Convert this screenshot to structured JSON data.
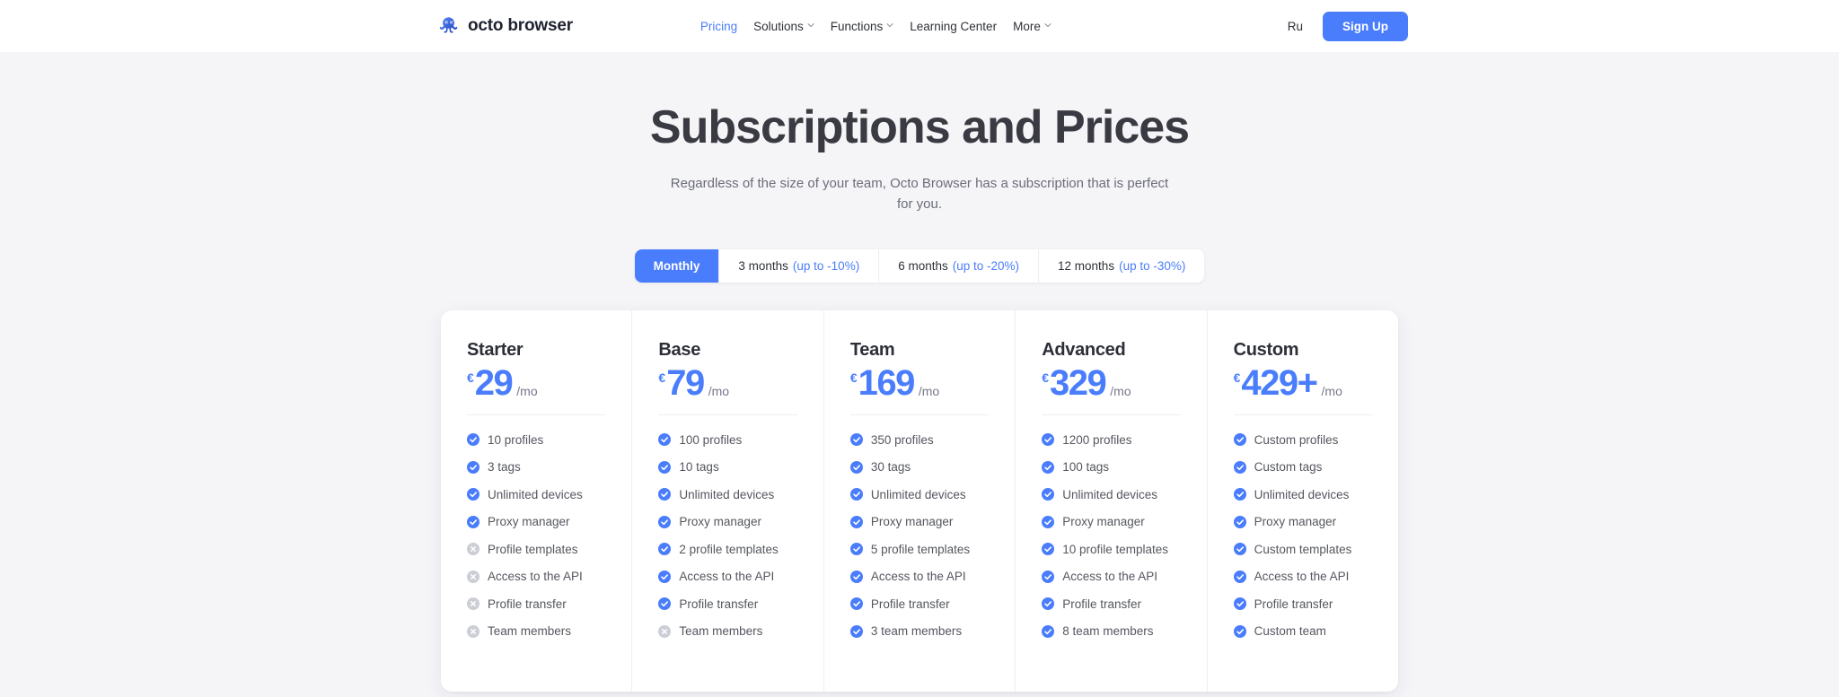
{
  "header": {
    "brand": {
      "name": "octo browser",
      "logo_icon": "octopus-logo-icon"
    },
    "nav": [
      {
        "label": "Pricing",
        "active": true,
        "has_caret": false
      },
      {
        "label": "Solutions",
        "active": false,
        "has_caret": true
      },
      {
        "label": "Functions",
        "active": false,
        "has_caret": true
      },
      {
        "label": "Learning Center",
        "active": false,
        "has_caret": false
      },
      {
        "label": "More",
        "active": false,
        "has_caret": true
      }
    ],
    "language": "Ru",
    "signup_label": "Sign Up"
  },
  "hero": {
    "title": "Subscriptions and Prices",
    "subtitle": "Regardless of the size of your team, Octo Browser has a subscription that is perfect for you."
  },
  "billing": {
    "tabs": [
      {
        "label": "Monthly",
        "discount": "",
        "active": true
      },
      {
        "label": "3 months",
        "discount": "(up to -10%)",
        "active": false
      },
      {
        "label": "6 months",
        "discount": "(up to -20%)",
        "active": false
      },
      {
        "label": "12 months",
        "discount": "(up to -30%)",
        "active": false
      }
    ]
  },
  "colors": {
    "accent": "#4a7dfc",
    "page_bg": "#f5f5f8",
    "card_bg": "#ffffff",
    "text": "#55575f",
    "heading": "#3a3a42",
    "disabled_icon": "#ccced6"
  },
  "plans": [
    {
      "name": "Starter",
      "currency": "€",
      "price": "29",
      "period": "/mo",
      "features": [
        {
          "label": "10 profiles",
          "included": true
        },
        {
          "label": "3 tags",
          "included": true
        },
        {
          "label": "Unlimited devices",
          "included": true
        },
        {
          "label": "Proxy manager",
          "included": true
        },
        {
          "label": "Profile templates",
          "included": false
        },
        {
          "label": "Access to the API",
          "included": false
        },
        {
          "label": "Profile transfer",
          "included": false
        },
        {
          "label": "Team members",
          "included": false
        }
      ]
    },
    {
      "name": "Base",
      "currency": "€",
      "price": "79",
      "period": "/mo",
      "features": [
        {
          "label": "100 profiles",
          "included": true
        },
        {
          "label": "10 tags",
          "included": true
        },
        {
          "label": "Unlimited devices",
          "included": true
        },
        {
          "label": "Proxy manager",
          "included": true
        },
        {
          "label": "2 profile templates",
          "included": true
        },
        {
          "label": "Access to the API",
          "included": true
        },
        {
          "label": "Profile transfer",
          "included": true
        },
        {
          "label": "Team members",
          "included": false
        }
      ]
    },
    {
      "name": "Team",
      "currency": "€",
      "price": "169",
      "period": "/mo",
      "features": [
        {
          "label": "350 profiles",
          "included": true
        },
        {
          "label": "30 tags",
          "included": true
        },
        {
          "label": "Unlimited devices",
          "included": true
        },
        {
          "label": "Proxy manager",
          "included": true
        },
        {
          "label": "5 profile templates",
          "included": true
        },
        {
          "label": "Access to the API",
          "included": true
        },
        {
          "label": "Profile transfer",
          "included": true
        },
        {
          "label": "3 team members",
          "included": true
        }
      ]
    },
    {
      "name": "Advanced",
      "currency": "€",
      "price": "329",
      "period": "/mo",
      "features": [
        {
          "label": "1200 profiles",
          "included": true
        },
        {
          "label": "100 tags",
          "included": true
        },
        {
          "label": "Unlimited devices",
          "included": true
        },
        {
          "label": "Proxy manager",
          "included": true
        },
        {
          "label": "10 profile templates",
          "included": true
        },
        {
          "label": "Access to the API",
          "included": true
        },
        {
          "label": "Profile transfer",
          "included": true
        },
        {
          "label": "8 team members",
          "included": true
        }
      ]
    },
    {
      "name": "Custom",
      "currency": "€",
      "price": "429+",
      "period": "/mo",
      "features": [
        {
          "label": "Custom profiles",
          "included": true
        },
        {
          "label": "Custom tags",
          "included": true
        },
        {
          "label": "Unlimited devices",
          "included": true
        },
        {
          "label": "Proxy manager",
          "included": true
        },
        {
          "label": "Custom templates",
          "included": true
        },
        {
          "label": "Access to the API",
          "included": true
        },
        {
          "label": "Profile transfer",
          "included": true
        },
        {
          "label": "Custom team",
          "included": true
        }
      ]
    }
  ]
}
